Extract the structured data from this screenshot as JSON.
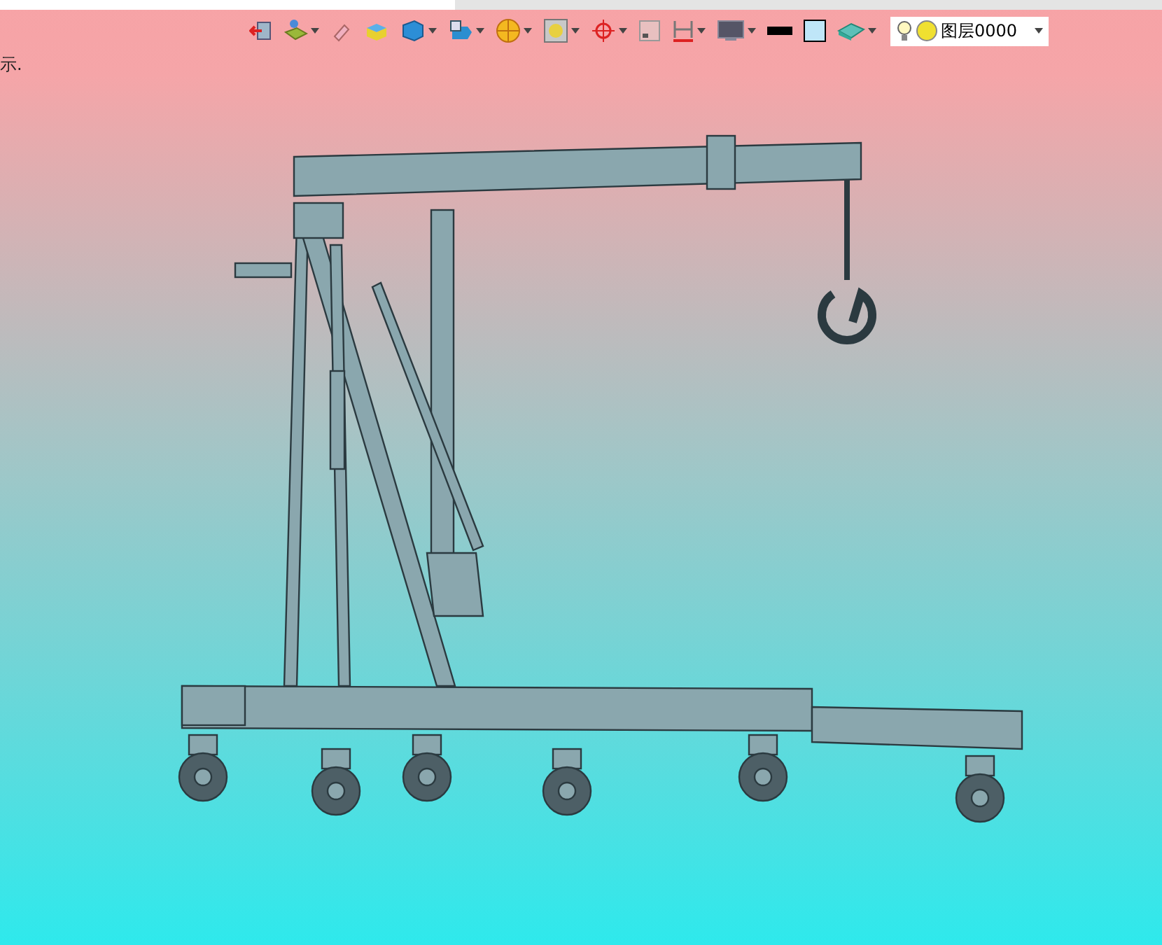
{
  "toolbar": {
    "buttons": [
      {
        "kind": "exit",
        "dropdown": false
      },
      {
        "kind": "layers",
        "dropdown": true
      },
      {
        "kind": "eraser",
        "dropdown": false
      },
      {
        "kind": "box",
        "dropdown": false
      },
      {
        "kind": "cube",
        "dropdown": true
      },
      {
        "kind": "view",
        "dropdown": true
      },
      {
        "kind": "sphere",
        "dropdown": true
      },
      {
        "kind": "render",
        "dropdown": true
      },
      {
        "kind": "target",
        "dropdown": true
      },
      {
        "kind": "frame",
        "dropdown": false
      },
      {
        "kind": "dimension",
        "dropdown": true
      },
      {
        "kind": "monitor",
        "dropdown": true
      },
      {
        "kind": "line",
        "dropdown": false
      },
      {
        "kind": "fill",
        "dropdown": false
      },
      {
        "kind": "material",
        "dropdown": true
      }
    ],
    "layer_select": {
      "value": "图层0000"
    }
  },
  "caption": "示."
}
